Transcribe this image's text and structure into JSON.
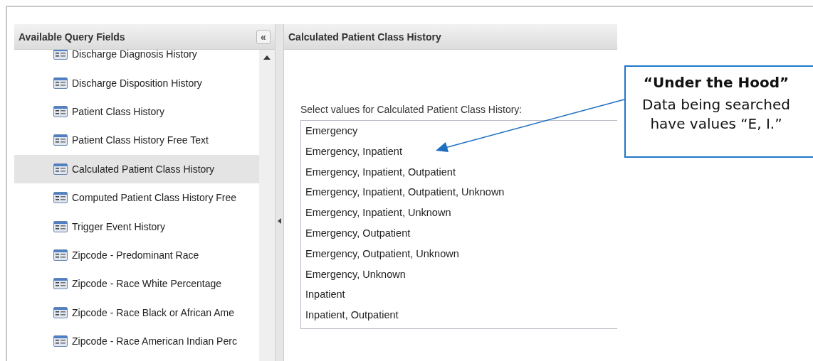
{
  "left_panel": {
    "title": "Available Query Fields",
    "collapse_button": "«",
    "items": [
      {
        "label": "Discharge Diagnosis History",
        "selected": false
      },
      {
        "label": "Discharge Disposition History",
        "selected": false
      },
      {
        "label": "Patient Class History",
        "selected": false
      },
      {
        "label": "Patient Class History Free Text",
        "selected": false
      },
      {
        "label": "Calculated Patient Class History",
        "selected": true
      },
      {
        "label": "Computed Patient Class History Free",
        "selected": false
      },
      {
        "label": "Trigger Event History",
        "selected": false
      },
      {
        "label": "Zipcode - Predominant Race",
        "selected": false
      },
      {
        "label": "Zipcode - Race White Percentage",
        "selected": false
      },
      {
        "label": "Zipcode - Race Black or African Ame",
        "selected": false
      },
      {
        "label": "Zipcode - Race American Indian Perc",
        "selected": false
      }
    ]
  },
  "right_panel": {
    "title": "Calculated Patient Class History",
    "prompt": "Select values for Calculated Patient Class History:",
    "options": [
      "Emergency",
      "Emergency, Inpatient",
      "Emergency, Inpatient, Outpatient",
      "Emergency, Inpatient, Outpatient, Unknown",
      "Emergency, Inpatient, Unknown",
      "Emergency, Outpatient",
      "Emergency, Outpatient, Unknown",
      "Emergency, Unknown",
      "Inpatient",
      "Inpatient, Outpatient"
    ]
  },
  "callout": {
    "title": "“Under the Hood”",
    "text": "Data being searched have values “E, I.”"
  }
}
